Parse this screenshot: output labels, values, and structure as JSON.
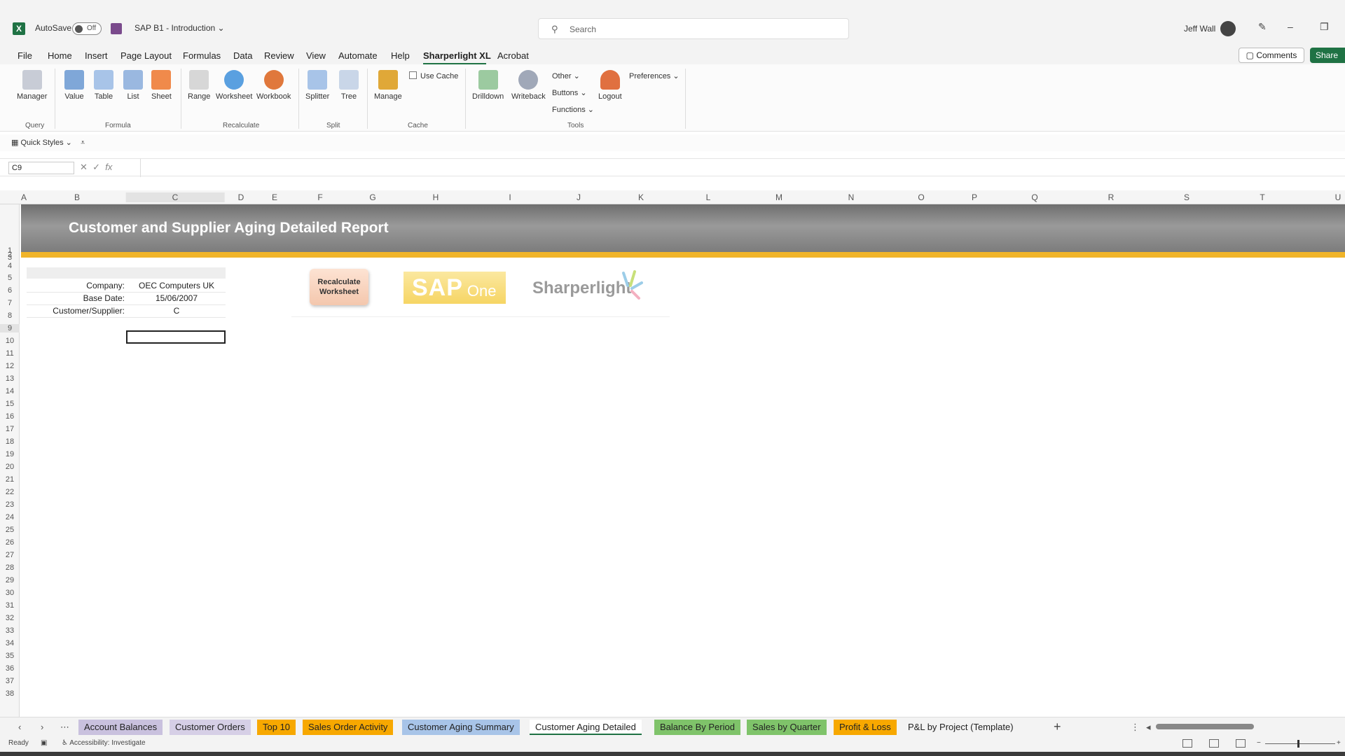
{
  "titlebar": {
    "autosave_label": "AutoSave",
    "autosave_state": "Off",
    "document_title": "SAP B1 - Introduction",
    "search_placeholder": "Search",
    "user_name": "Jeff Wall"
  },
  "menu": {
    "items": [
      "File",
      "Home",
      "Insert",
      "Page Layout",
      "Formulas",
      "Data",
      "Review",
      "View",
      "Automate",
      "Help",
      "Sharperlight XL",
      "Acrobat"
    ],
    "active": "Sharperlight XL",
    "comments_label": "Comments",
    "share_label": "Share"
  },
  "ribbon": {
    "query": {
      "label": "Query",
      "manager": "Manager"
    },
    "formula": {
      "label": "Formula",
      "value": "Value",
      "table": "Table",
      "list": "List",
      "sheet": "Sheet"
    },
    "recalculate": {
      "label": "Recalculate",
      "range": "Range",
      "worksheet": "Worksheet",
      "workbook": "Workbook"
    },
    "split": {
      "label": "Split",
      "splitter": "Splitter",
      "tree": "Tree"
    },
    "cache": {
      "label": "Cache",
      "manage": "Manage",
      "use_cache": "Use Cache"
    },
    "tools": {
      "label": "Tools",
      "drilldown": "Drilldown",
      "writeback": "Writeback",
      "other": "Other",
      "buttons": "Buttons",
      "functions": "Functions",
      "logout": "Logout",
      "preferences": "Preferences"
    }
  },
  "quick_styles": "Quick Styles",
  "formula_bar": {
    "name_box": "C9",
    "fx": "fx"
  },
  "columns": [
    "A",
    "B",
    "C",
    "D",
    "E",
    "F",
    "G",
    "H",
    "I",
    "J",
    "K",
    "L",
    "M",
    "N",
    "O",
    "P",
    "Q",
    "R",
    "S",
    "T",
    "U"
  ],
  "rows": [
    "1",
    "2",
    "3",
    "4",
    "5",
    "6",
    "7",
    "8",
    "9",
    "10",
    "11",
    "12",
    "13",
    "14",
    "15",
    "16",
    "17",
    "18",
    "19",
    "20",
    "21",
    "22",
    "23",
    "24",
    "25",
    "26",
    "27",
    "28",
    "29",
    "30",
    "31",
    "32",
    "33",
    "34",
    "35",
    "36",
    "37",
    "38"
  ],
  "report": {
    "title": "Customer and Supplier Aging Detailed Report",
    "params": [
      {
        "label": "Company:",
        "value": "OEC Computers UK"
      },
      {
        "label": "Base Date:",
        "value": "15/06/2007"
      },
      {
        "label": "Customer/Supplier:",
        "value": "C"
      }
    ],
    "recalc_button": "Recalculate Worksheet",
    "sap_logo_text": "SAP",
    "sap_logo_sub": "One",
    "sharperlight_logo": "Sharperlight"
  },
  "sheet_tabs": [
    {
      "label": "Account Balances",
      "color": "#c9c1de"
    },
    {
      "label": "Customer Orders",
      "color": "#d6cfe6"
    },
    {
      "label": "Top 10",
      "color": "#f7a800"
    },
    {
      "label": "Sales Order Activity",
      "color": "#f7a800"
    },
    {
      "label": "Customer Aging Summary",
      "color": "#a8c4e8"
    },
    {
      "label": "Customer Aging Detailed",
      "color": "#ffffff"
    },
    {
      "label": "Balance By Period",
      "color": "#7fc36a"
    },
    {
      "label": "Sales by Quarter",
      "color": "#7fc36a"
    },
    {
      "label": "Profit & Loss",
      "color": "#f7a800"
    },
    {
      "label": "P&L by Project (Template)",
      "color": "#f3f3f3"
    }
  ],
  "status": {
    "ready": "Ready",
    "accessibility": "Accessibility: Investigate"
  },
  "colors": {
    "excel_green": "#1f7244",
    "banner_gray": "#7c7c7c",
    "accent_orange": "#f0b429"
  }
}
